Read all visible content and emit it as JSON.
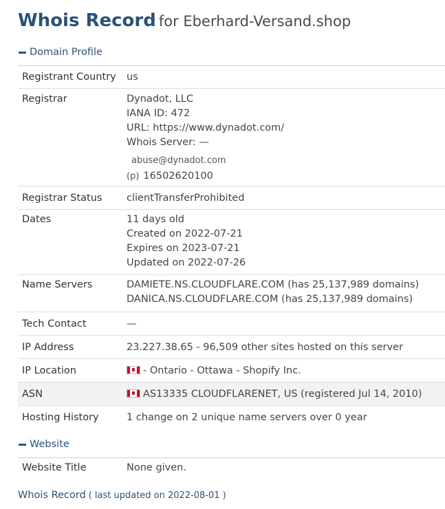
{
  "header": {
    "title_main": "Whois Record",
    "title_for": "for Eberhard-Versand.shop"
  },
  "domain_profile": {
    "heading": "Domain Profile",
    "registrant_country": {
      "label": "Registrant Country",
      "value": "us"
    },
    "registrar": {
      "label": "Registrar",
      "name": "Dynadot, LLC",
      "iana": "IANA ID: 472",
      "url": "URL: https://www.dynadot.com/",
      "whois_server": "Whois Server: —",
      "email": "abuse@dynadot.com",
      "phone_prefix": "(p)",
      "phone": "16502620100"
    },
    "registrar_status": {
      "label": "Registrar Status",
      "value": "clientTransferProhibited"
    },
    "dates": {
      "label": "Dates",
      "age": "11 days old",
      "created": "Created on 2022-07-21",
      "expires": "Expires on 2023-07-21",
      "updated": "Updated on 2022-07-26"
    },
    "name_servers": {
      "label": "Name Servers",
      "ns1": "DAMIETE.NS.CLOUDFLARE.COM (has 25,137,989 domains)",
      "ns2": "DANICA.NS.CLOUDFLARE.COM (has 25,137,989 domains)"
    },
    "tech_contact": {
      "label": "Tech Contact",
      "value": "—"
    },
    "ip_address": {
      "label": "IP Address",
      "value": "23.227.38.65 - 96,509 other sites hosted on this server"
    },
    "ip_location": {
      "label": "IP Location",
      "value": "- Ontario - Ottawa - Shopify Inc.",
      "flag_icon": "canada-flag-icon"
    },
    "asn": {
      "label": "ASN",
      "value": "AS13335 CLOUDFLARENET, US (registered Jul 14, 2010)",
      "flag_icon": "canada-flag-icon"
    },
    "hosting_history": {
      "label": "Hosting History",
      "value": "1 change on 2 unique name servers over 0 year"
    }
  },
  "website": {
    "heading": "Website",
    "website_title": {
      "label": "Website Title",
      "value": "None given."
    }
  },
  "footer": {
    "link": "Whois Record",
    "note": "( last updated on 2022-08-01 )"
  },
  "colors": {
    "accent": "#2a5277",
    "shaded_row": "#f2f2f2"
  }
}
